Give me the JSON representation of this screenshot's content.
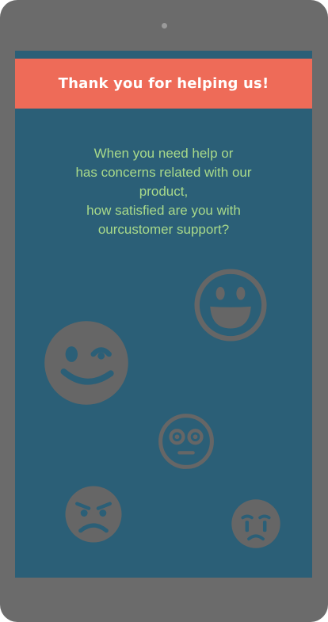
{
  "header": {
    "title": "Thank you for helping us!"
  },
  "question": {
    "text": "When you need help or\nhas concerns related with our\nproduct,\nhow satisfied are you with\nourcustomer support?"
  },
  "emojis": [
    {
      "name": "grinning-face",
      "icon": "grinning-face-icon"
    },
    {
      "name": "winking-face",
      "icon": "winking-face-icon"
    },
    {
      "name": "flushed-face",
      "icon": "flushed-face-icon"
    },
    {
      "name": "angry-face",
      "icon": "angry-face-icon"
    },
    {
      "name": "crying-face",
      "icon": "crying-face-icon"
    }
  ],
  "colors": {
    "device_frame": "#6b6b6b",
    "screen_background": "#2b5f77",
    "header_background": "#ee6b58",
    "header_text": "#ffffff",
    "question_text": "#a8d98a",
    "emoji_fill": "#666666"
  }
}
